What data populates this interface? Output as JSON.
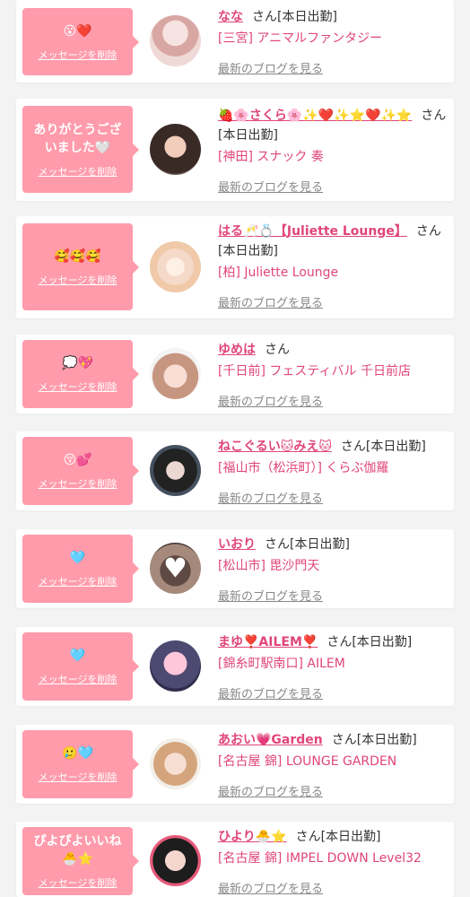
{
  "delete_label": "メッセージを削除",
  "blog_label": "最新のブログを見る",
  "honorific": "さん",
  "cards": [
    {
      "message": "😮❤️",
      "name": "なな",
      "status": "[本日出勤]",
      "shop": "[三宮] アニマルファンタジー"
    },
    {
      "message": "ありがとうございました🤍",
      "name": "🍓🌸さくら🌸✨❤️✨⭐❤️✨⭐",
      "status": "[本日出勤]",
      "shop": "[神田] スナック 奏"
    },
    {
      "message": "🥰🥰🥰",
      "name": "はる🥂💍【Juliette Lounge】",
      "status": "[本日出勤]",
      "shop": "[柏] Juliette Lounge"
    },
    {
      "message": "💭💖",
      "name": "ゆめは",
      "status": "",
      "shop": "[千日前] フェスティバル 千日前店"
    },
    {
      "message": "😚💕",
      "name": "ねこぐるい🐱みえ🐱",
      "status": "[本日出勤]",
      "shop": "[福山市（松浜町）] くらぶ伽羅"
    },
    {
      "message": "🩵",
      "name": "いおり",
      "status": "[本日出勤]",
      "shop": "[松山市] 毘沙門天"
    },
    {
      "message": "🩵",
      "name": "まゆ❣️AILEM❣️",
      "status": "[本日出勤]",
      "shop": "[錦糸町駅南口] AILEM"
    },
    {
      "message": "🥲🩵",
      "name": "あおい💗Garden",
      "status": "[本日出勤]",
      "shop": "[名古屋 錦] LOUNGE GARDEN"
    },
    {
      "message": "ぴよぴよいいね🐣⭐",
      "name": "ひより🐣⭐",
      "status": "[本日出勤]",
      "shop": "[名古屋 錦] IMPEL DOWN Level32"
    }
  ]
}
